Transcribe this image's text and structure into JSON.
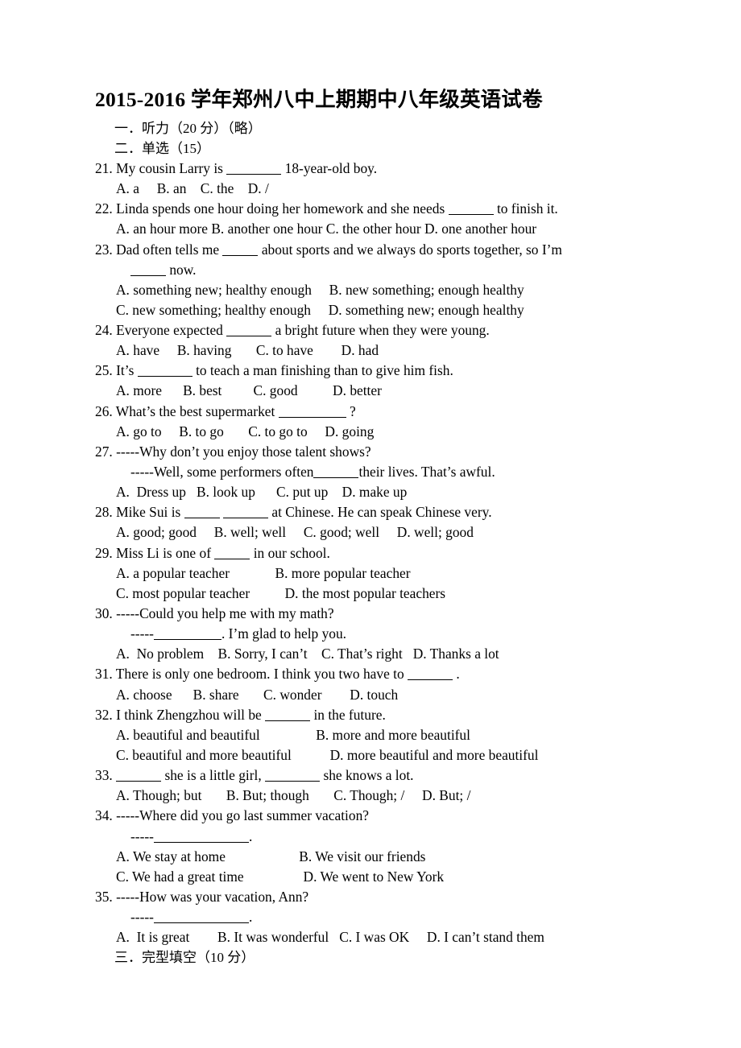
{
  "document": {
    "title": "2015-2016 学年郑州八中上期期中八年级英语试卷",
    "sections": [
      {
        "label": "一．听力（20 分）（略）"
      },
      {
        "label": "二．单选（15）"
      },
      {
        "label": "三．完型填空（10 分）"
      }
    ]
  },
  "questions": [
    {
      "number": "21.",
      "stem_before": "My cousin Larry is",
      "stem_after": "18-year-old boy.",
      "blank": "b-lg",
      "option_lines": [
        "A. a     B. an    C. the    D. /"
      ]
    },
    {
      "number": "22.",
      "stem_before": "Linda spends one hour doing her homework and she needs",
      "stem_after": "to finish it.",
      "blank": "b-md",
      "option_lines": [
        "A. an hour more B. another one hour C. the other hour D. one another hour"
      ]
    },
    {
      "number": "23.",
      "stem_before": "Dad often tells me",
      "stem_after": "about sports and we always do sports together, so I’m",
      "blank": "b-sm",
      "continuation_blank": "b-sm",
      "continuation_after": "now.",
      "option_lines": [
        "A. something new; healthy enough     B. new something; enough healthy",
        "C. new something; healthy enough     D. something new; enough healthy"
      ]
    },
    {
      "number": "24.",
      "stem_before": "Everyone expected",
      "stem_after": "a bright future when they were young.",
      "blank": "b-md",
      "option_lines": [
        "A. have     B. having       C. to have        D. had"
      ]
    },
    {
      "number": "25.",
      "stem_before": "It’s",
      "stem_after": "to teach a man finishing than to give him fish.",
      "blank": "b-lg",
      "option_lines": [
        "A. more      B. best         C. good          D. better"
      ]
    },
    {
      "number": "26.",
      "stem_before": "What’s the best supermarket",
      "stem_after": "?",
      "blank": "b-xl",
      "option_lines": [
        "A. go to     B. to go       C. to go to     D. going"
      ]
    },
    {
      "number": "27.",
      "stem_before": "-----Why don’t you enjoy those talent shows?",
      "stem_after": "",
      "blank": "none",
      "dialog_line_before": "-----Well, some performers often",
      "dialog_blank": "b-md",
      "dialog_line_after": "their lives. That’s awful.",
      "option_lines": [
        "A.  Dress up   B. look up      C. put up    D. make up"
      ]
    },
    {
      "number": "28.",
      "stem_before": "Mike Sui is",
      "stem_after": "at Chinese. He can speak Chinese very",
      "stem_tail": ".",
      "blank": "b-sm",
      "blank2": "b-md",
      "option_lines": [
        "A. good; good     B. well; well     C. good; well     D. well; good"
      ]
    },
    {
      "number": "29.",
      "stem_before": "Miss Li is one of",
      "stem_after": "in our school.",
      "blank": "b-sm",
      "option_lines": [
        "A. a popular teacher             B. more popular teacher",
        "C. most popular teacher          D. the most popular teachers"
      ]
    },
    {
      "number": "30.",
      "stem_before": "-----Could you help me with my math?",
      "stem_after": "",
      "blank": "none",
      "dialog_line_before": "-----",
      "dialog_blank": "b-xl",
      "dialog_line_after": ". I’m glad to help you.",
      "option_lines": [
        "A.  No problem    B. Sorry, I can’t    C. That’s right   D. Thanks a lot"
      ]
    },
    {
      "number": "31.",
      "stem_before": "There is only one bedroom. I think you two have to",
      "stem_after": ".",
      "blank": "b-md",
      "option_lines": [
        "A. choose      B. share       C. wonder        D. touch"
      ]
    },
    {
      "number": "32.",
      "stem_before": "I think Zhengzhou will be",
      "stem_after": "in the future.",
      "blank": "b-md",
      "option_lines": [
        "A. beautiful and beautiful                B. more and more beautiful",
        "C. beautiful and more beautiful           D. more beautiful and more beautiful"
      ]
    },
    {
      "number": "33.",
      "stem_before": "",
      "stem_mid": "she is a little girl,",
      "stem_after": "she knows a lot.",
      "blank": "b-md",
      "blank2": "b-lg",
      "option_lines": [
        "A. Though; but       B. But; though       C. Though; /     D. But; /"
      ]
    },
    {
      "number": "34.",
      "stem_before": "-----Where did you go last summer vacation?",
      "stem_after": "",
      "blank": "none",
      "dialog_line_before": "-----",
      "dialog_blank": "b-xxl",
      "dialog_line_after": ".",
      "option_lines": [
        "A. We stay at home                     B. We visit our friends",
        "C. We had a great time                 D. We went to New York"
      ]
    },
    {
      "number": "35.",
      "stem_before": "-----How was your vacation, Ann?",
      "stem_after": "",
      "blank": "none",
      "dialog_line_before": "-----",
      "dialog_blank": "b-xxl",
      "dialog_line_after": ".",
      "option_lines": [
        "A.  It is great        B. It was wonderful   C. I was OK     D. I can’t stand them"
      ]
    }
  ]
}
